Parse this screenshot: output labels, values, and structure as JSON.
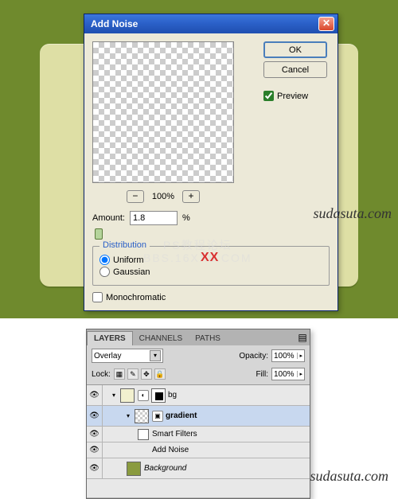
{
  "dialog": {
    "title": "Add Noise",
    "ok_label": "OK",
    "cancel_label": "Cancel",
    "preview_label": "Preview",
    "preview_checked": true,
    "zoom_minus": "−",
    "zoom_pct": "100%",
    "zoom_plus": "+",
    "amount_label": "Amount:",
    "amount_value": "1.8",
    "amount_unit": "%",
    "distribution_legend": "Distribution",
    "uniform_label": "Uniform",
    "gaussian_label": "Gaussian",
    "distribution_selected": "uniform",
    "mono_label": "Monochromatic",
    "mono_checked": false
  },
  "watermarks": {
    "suda1": "sudasuta.com",
    "center_line1": "PS教程论坛",
    "center_line2": "BBS.16XX8.COM",
    "xx": "XX",
    "suda2": "sudasuta.com"
  },
  "layers": {
    "tabs": [
      "LAYERS",
      "CHANNELS",
      "PATHS"
    ],
    "active_tab": "LAYERS",
    "blend_mode": "Overlay",
    "opacity_label": "Opacity:",
    "opacity_value": "100%",
    "lock_label": "Lock:",
    "fill_label": "Fill:",
    "fill_value": "100%",
    "rows": {
      "bg_group": {
        "name": "bg"
      },
      "gradient": {
        "name": "gradient"
      },
      "smart_filters": {
        "name": "Smart Filters"
      },
      "add_noise": {
        "name": "Add Noise"
      },
      "background": {
        "name": "Background"
      }
    }
  }
}
